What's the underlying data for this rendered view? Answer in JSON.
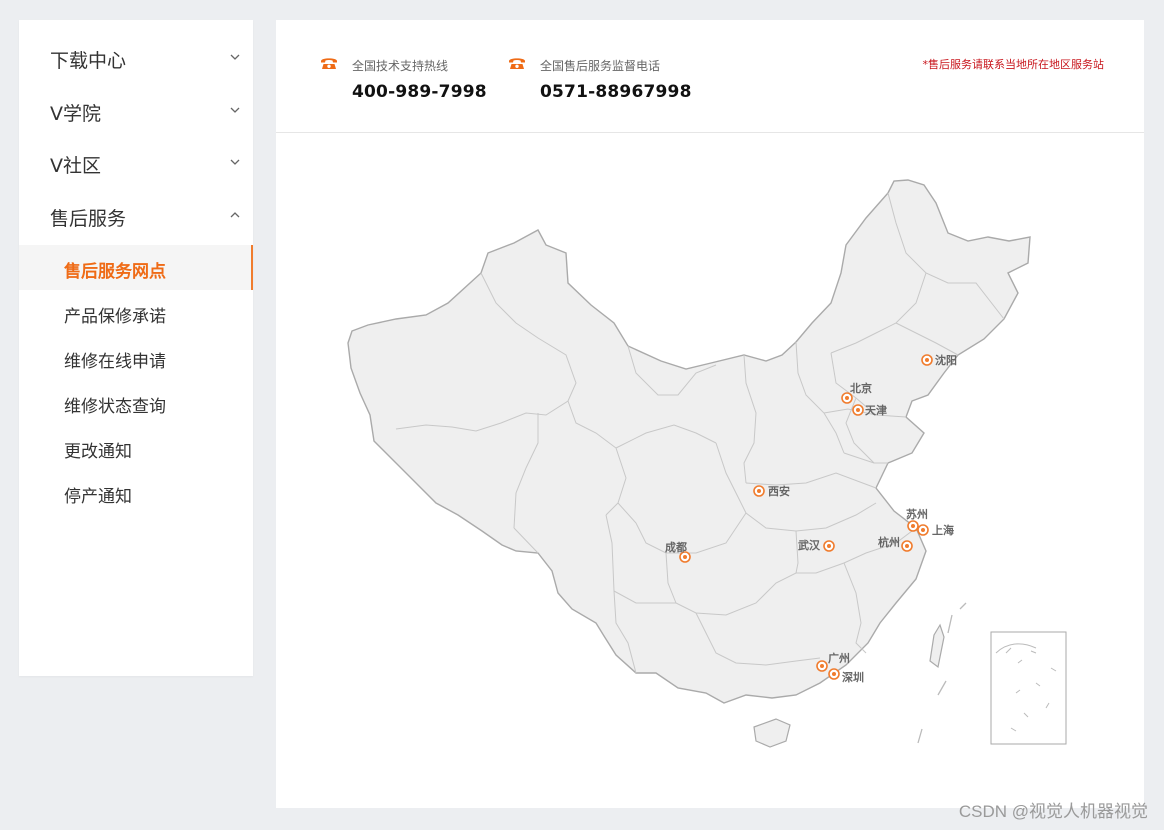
{
  "sidebar": {
    "groups": [
      {
        "label": "下载中心",
        "expanded": false
      },
      {
        "label": "V学院",
        "expanded": false
      },
      {
        "label": "V社区",
        "expanded": false
      },
      {
        "label": "售后服务",
        "expanded": true
      }
    ],
    "sub_items": [
      {
        "label": "售后服务网点",
        "active": true
      },
      {
        "label": "产品保修承诺",
        "active": false
      },
      {
        "label": "维修在线申请",
        "active": false
      },
      {
        "label": "维修状态查询",
        "active": false
      },
      {
        "label": "更改通知",
        "active": false
      },
      {
        "label": "停产通知",
        "active": false
      }
    ]
  },
  "hotlines": [
    {
      "caption": "全国技术支持热线",
      "number": "400-989-7998",
      "icon": "phone-icon"
    },
    {
      "caption": "全国售后服务监督电话",
      "number": "0571-88967998",
      "icon": "phone-icon"
    }
  ],
  "notice": "*售后服务请联系当地所在地区服务站",
  "map": {
    "cities": [
      "沈阳",
      "北京",
      "天津",
      "西安",
      "苏州",
      "上海",
      "杭州",
      "成都",
      "武汉",
      "广州",
      "深圳"
    ]
  },
  "watermark": "CSDN @视觉人机器视觉",
  "colors": {
    "accent": "#ef6b16",
    "notice": "#c8161d",
    "map_fill": "#efefef",
    "map_stroke": "#aaaaaa"
  }
}
